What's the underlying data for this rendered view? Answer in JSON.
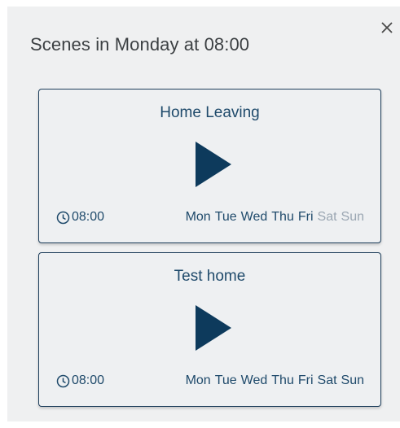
{
  "dialog": {
    "title": "Scenes in Monday at 08:00",
    "close_icon": "close-icon"
  },
  "colors": {
    "accent": "#1f4a6b",
    "inactive_day": "#9aa6b2",
    "background": "#eff0f1"
  },
  "scenes": [
    {
      "name": "Home Leaving",
      "time": "08:00",
      "days": [
        {
          "label": "Mon",
          "active": true
        },
        {
          "label": "Tue",
          "active": true
        },
        {
          "label": "Wed",
          "active": true
        },
        {
          "label": "Thu",
          "active": true
        },
        {
          "label": "Fri",
          "active": true
        },
        {
          "label": "Sat",
          "active": false
        },
        {
          "label": "Sun",
          "active": false
        }
      ]
    },
    {
      "name": "Test home",
      "time": "08:00",
      "days": [
        {
          "label": "Mon",
          "active": true
        },
        {
          "label": "Tue",
          "active": true
        },
        {
          "label": "Wed",
          "active": true
        },
        {
          "label": "Thu",
          "active": true
        },
        {
          "label": "Fri",
          "active": true
        },
        {
          "label": "Sat",
          "active": true
        },
        {
          "label": "Sun",
          "active": true
        }
      ]
    }
  ]
}
